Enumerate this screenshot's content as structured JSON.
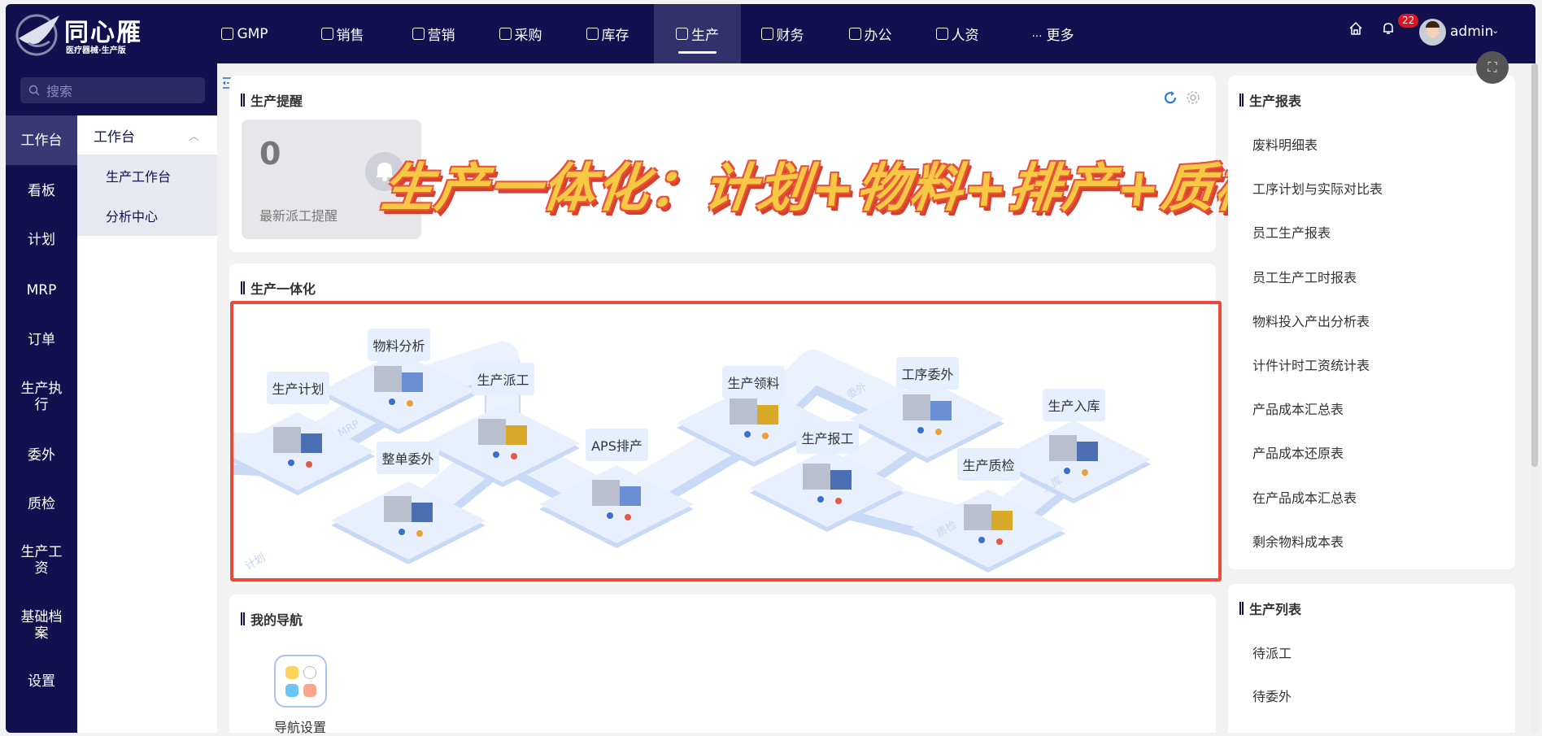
{
  "header": {
    "logo_title": "同心雁",
    "logo_subtitle": "医疗器械·生产版",
    "nav": [
      {
        "label": "GMP",
        "icon": "gmp-icon"
      },
      {
        "label": "销售",
        "icon": "chart-icon"
      },
      {
        "label": "营销",
        "icon": "bar-chart-icon"
      },
      {
        "label": "采购",
        "icon": "basket-icon"
      },
      {
        "label": "库存",
        "icon": "inventory-icon"
      },
      {
        "label": "生产",
        "icon": "robot-arm-icon",
        "active": true
      },
      {
        "label": "财务",
        "icon": "yen-icon"
      },
      {
        "label": "办公",
        "icon": "briefcase-icon"
      },
      {
        "label": "人资",
        "icon": "user-icon"
      },
      {
        "label": "更多",
        "icon": "more-icon"
      }
    ],
    "notification_count": "22",
    "username": "admin"
  },
  "sidebar": {
    "search_placeholder": "搜索",
    "items": [
      "工作台",
      "看板",
      "计划",
      "MRP",
      "订单",
      "生产执行",
      "委外",
      "质检",
      "生产工资",
      "基础档案",
      "设置"
    ],
    "active": "工作台",
    "submenu": {
      "title": "工作台",
      "items": [
        "生产工作台",
        "分析中心"
      ]
    }
  },
  "reminder": {
    "title": "生产提醒",
    "count": "0",
    "label": "最新派工提醒"
  },
  "banner": "生产一体化：计划+物料+排产+质检",
  "integration": {
    "title": "生产一体化",
    "steps": [
      "生产计划",
      "物料分析",
      "生产派工",
      "整单委外",
      "APS排产",
      "生产领料",
      "生产报工",
      "工序委外",
      "生产质检",
      "生产入库"
    ],
    "path_labels": [
      "计划",
      "MRP",
      "委外",
      "质检",
      "入库"
    ]
  },
  "my_nav": {
    "title": "我的导航",
    "items": [
      "导航设置"
    ]
  },
  "reports": {
    "title": "生产报表",
    "items": [
      "废料明细表",
      "工序计划与实际对比表",
      "员工生产报表",
      "员工生产工时报表",
      "物料投入产出分析表",
      "计件计时工资统计表",
      "产品成本汇总表",
      "产品成本还原表",
      "在产品成本汇总表",
      "剩余物料成本表"
    ]
  },
  "lists": {
    "title": "生产列表",
    "items": [
      "待派工",
      "待委外"
    ]
  },
  "colors": {
    "header": "#12104e",
    "highlight": "#e84a3c",
    "banner_fill": "#f7c843",
    "badge": "#e0141e"
  }
}
